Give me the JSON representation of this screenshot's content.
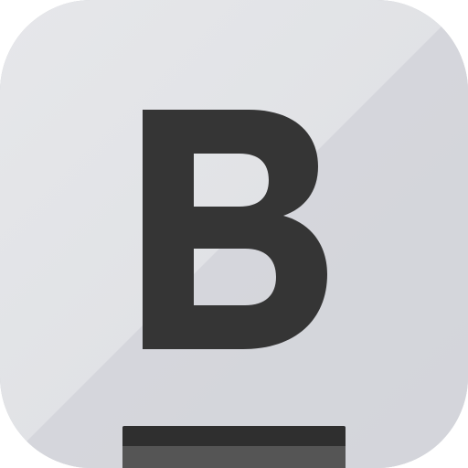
{
  "app_icon": {
    "letter": "B",
    "colors": {
      "tile_light": "#e3e4e7",
      "tile_dark": "#d1d3d8",
      "letter": "#353535",
      "shelf_top": "#2f2f2f",
      "shelf_bottom": "#555555"
    },
    "icon_name": "bold-b-app-icon"
  }
}
